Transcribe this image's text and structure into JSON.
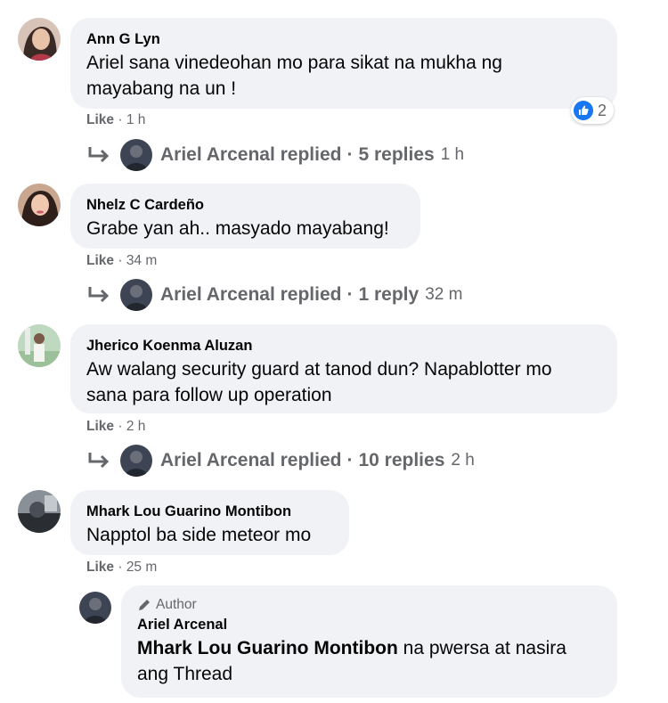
{
  "comments": [
    {
      "author": "Ann G Lyn",
      "text_line1": "Ariel sana vinedeohan mo para sikat na mukha ng",
      "text_line2": "mayabang na un !",
      "like": "Like",
      "time": "1 h",
      "reactions_count": "2",
      "replies": {
        "name": "Ariel Arcenal replied",
        "count": "5 replies",
        "time": "1 h"
      }
    },
    {
      "author": "Nhelz C Cardeño",
      "text_line1": "Grabe yan ah.. masyado mayabang!",
      "like": "Like",
      "time": "34 m",
      "replies": {
        "name": "Ariel Arcenal replied",
        "count": "1 reply",
        "time": "32 m"
      }
    },
    {
      "author": "Jherico Koenma Aluzan",
      "text_line1": "Aw walang security guard at tanod dun? Napablotter mo",
      "text_line2": "sana para follow up operation",
      "like": "Like",
      "time": "2 h",
      "replies": {
        "name": "Ariel Arcenal replied",
        "count": "10 replies",
        "time": "2 h"
      }
    },
    {
      "author": "Mhark Lou Guarino Montibon",
      "text_line1": "Napptol ba side meteor mo",
      "like": "Like",
      "time": "25 m"
    }
  ],
  "nested_reply": {
    "badge": "Author",
    "author": "Ariel Arcenal",
    "mention": "Mhark Lou Guarino Montibon",
    "text_line1": " na pwersa at nasira",
    "text_line2": "ang Thread"
  },
  "separator": "·",
  "colors": {
    "bubble": "#f0f2f5",
    "meta_text": "#65676b",
    "reaction_blue": "#1877f2"
  },
  "icons": {
    "reply_arrow": "reply-arrow-icon",
    "like_reaction": "like-reaction-icon",
    "author_badge": "pencil-icon"
  }
}
